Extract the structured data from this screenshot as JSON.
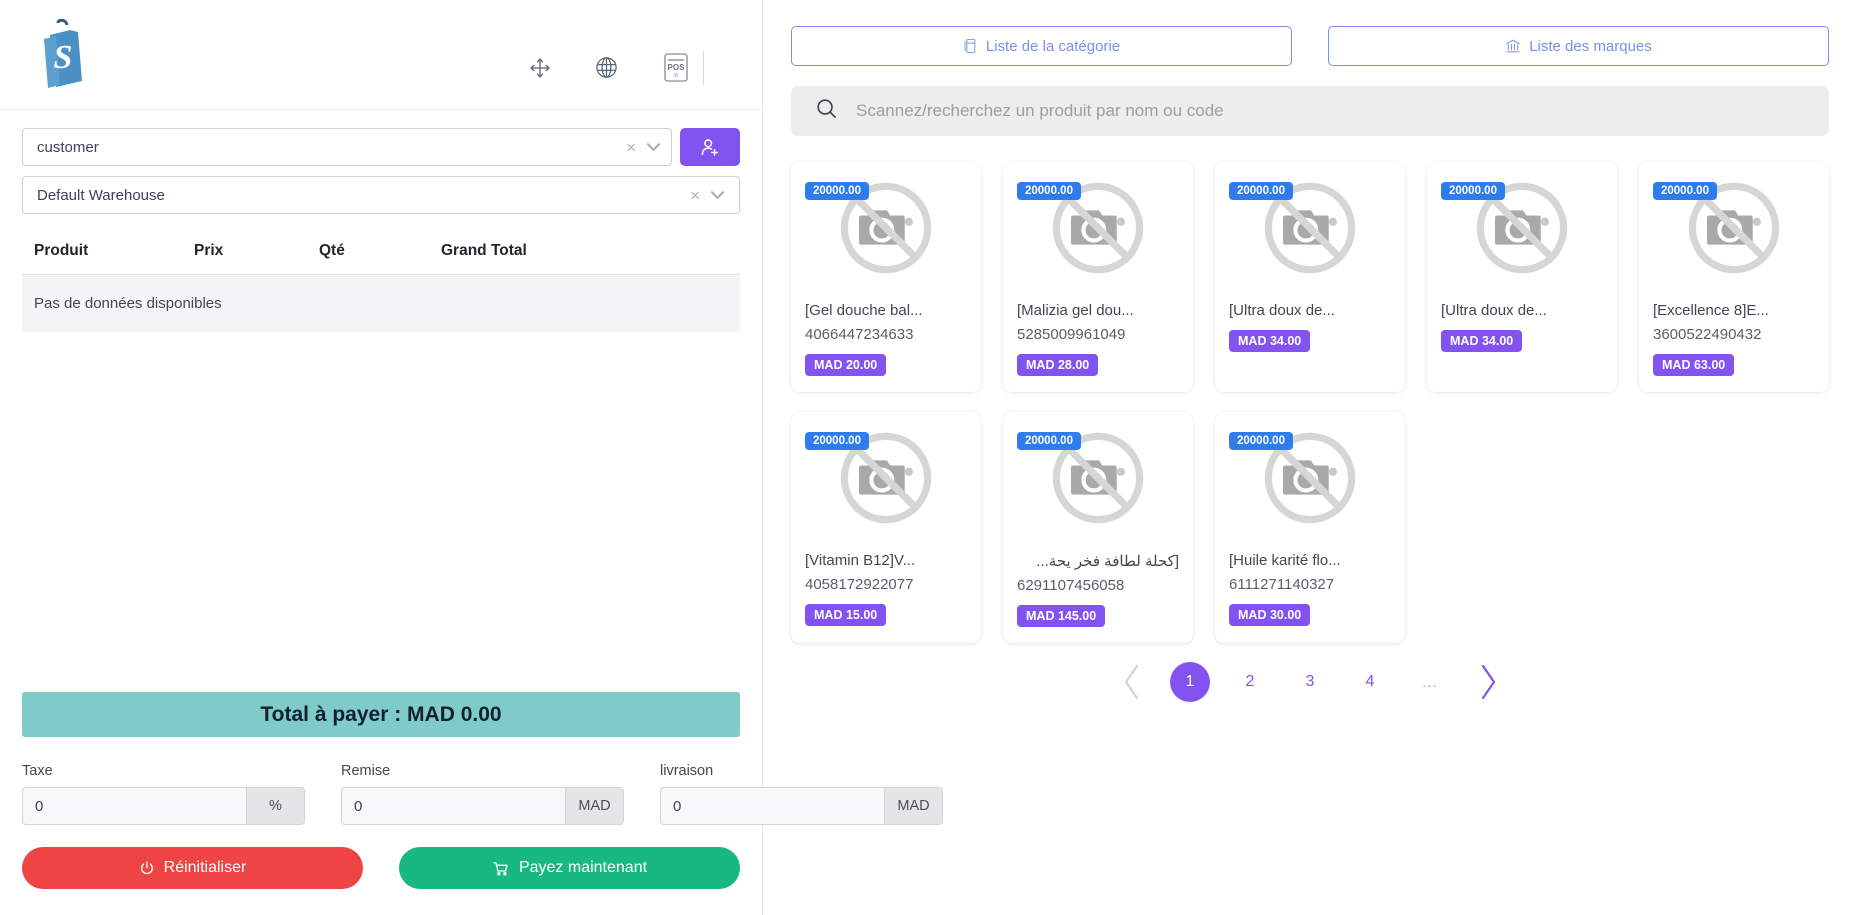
{
  "header": {
    "logo_name": "shopify-bag-logo",
    "icons": [
      {
        "name": "fullscreen-icon",
        "title": "Fullscreen"
      },
      {
        "name": "globe-icon",
        "title": "Language"
      },
      {
        "name": "pos-icon",
        "title": "POS",
        "label": "POS"
      }
    ]
  },
  "cart_panel": {
    "customer": {
      "value": "customer",
      "placeholder": "customer",
      "clear_label": "×",
      "add_button_name": "add-customer-button"
    },
    "warehouse": {
      "value": "Default Warehouse",
      "clear_label": "×"
    },
    "table": {
      "columns": [
        "Produit",
        "Prix",
        "Qté",
        "Grand Total"
      ],
      "empty_text": "Pas de données disponibles",
      "rows": []
    },
    "total_label": "Total à payer : MAD 0.00",
    "fields": [
      {
        "label": "Taxe",
        "value": "0",
        "suffix": "%",
        "name": "tax-input"
      },
      {
        "label": "Remise",
        "value": "0",
        "suffix": "MAD",
        "name": "discount-input"
      },
      {
        "label": "livraison",
        "value": "0",
        "suffix": "MAD",
        "name": "shipping-input"
      }
    ],
    "buttons": {
      "reset": "Réinitialiser",
      "pay": "Payez maintenant"
    },
    "colors": {
      "total_bar": "#7ecbca",
      "reset": "#ef4444",
      "pay": "#18b981",
      "accent_purple": "#8253f1"
    }
  },
  "product_panel": {
    "tabs": [
      {
        "label": "Liste de la catégorie",
        "icon": "category-list-icon"
      },
      {
        "label": "Liste des marques",
        "icon": "brand-bank-icon"
      }
    ],
    "search": {
      "placeholder": "Scannez/recherchez un produit par nom ou code",
      "value": "",
      "icon": "search-icon"
    },
    "products": [
      {
        "stock": "20000.00",
        "name": "[Gel douche bal...",
        "code": "4066447234633",
        "price": "MAD 20.00",
        "rtl": false
      },
      {
        "stock": "20000.00",
        "name": "[Malizia gel dou...",
        "code": "5285009961049",
        "price": "MAD 28.00",
        "rtl": false
      },
      {
        "stock": "20000.00",
        "name": "[Ultra doux de...",
        "code": "",
        "price": "MAD 34.00",
        "rtl": false
      },
      {
        "stock": "20000.00",
        "name": "[Ultra doux de...",
        "code": "",
        "price": "MAD 34.00",
        "rtl": false
      },
      {
        "stock": "20000.00",
        "name": "[Excellence 8]E...",
        "code": "3600522490432",
        "price": "MAD 63.00",
        "rtl": false
      },
      {
        "stock": "20000.00",
        "name": "[Vitamin B12]V...",
        "code": "4058172922077",
        "price": "MAD 15.00",
        "rtl": false
      },
      {
        "stock": "20000.00",
        "name": "[كحلة لطافة فخر يحة...",
        "code": "6291107456058",
        "price": "MAD 145.00",
        "rtl": true
      },
      {
        "stock": "20000.00",
        "name": "[Huile karité flo...",
        "code": "6111271140327",
        "price": "MAD 30.00",
        "rtl": false
      }
    ],
    "pagination": {
      "prev": "‹",
      "next": "›",
      "pages": [
        "1",
        "2",
        "3",
        "4",
        "..."
      ],
      "active": "1"
    },
    "placeholder_image": "no-image-camera-icon"
  }
}
